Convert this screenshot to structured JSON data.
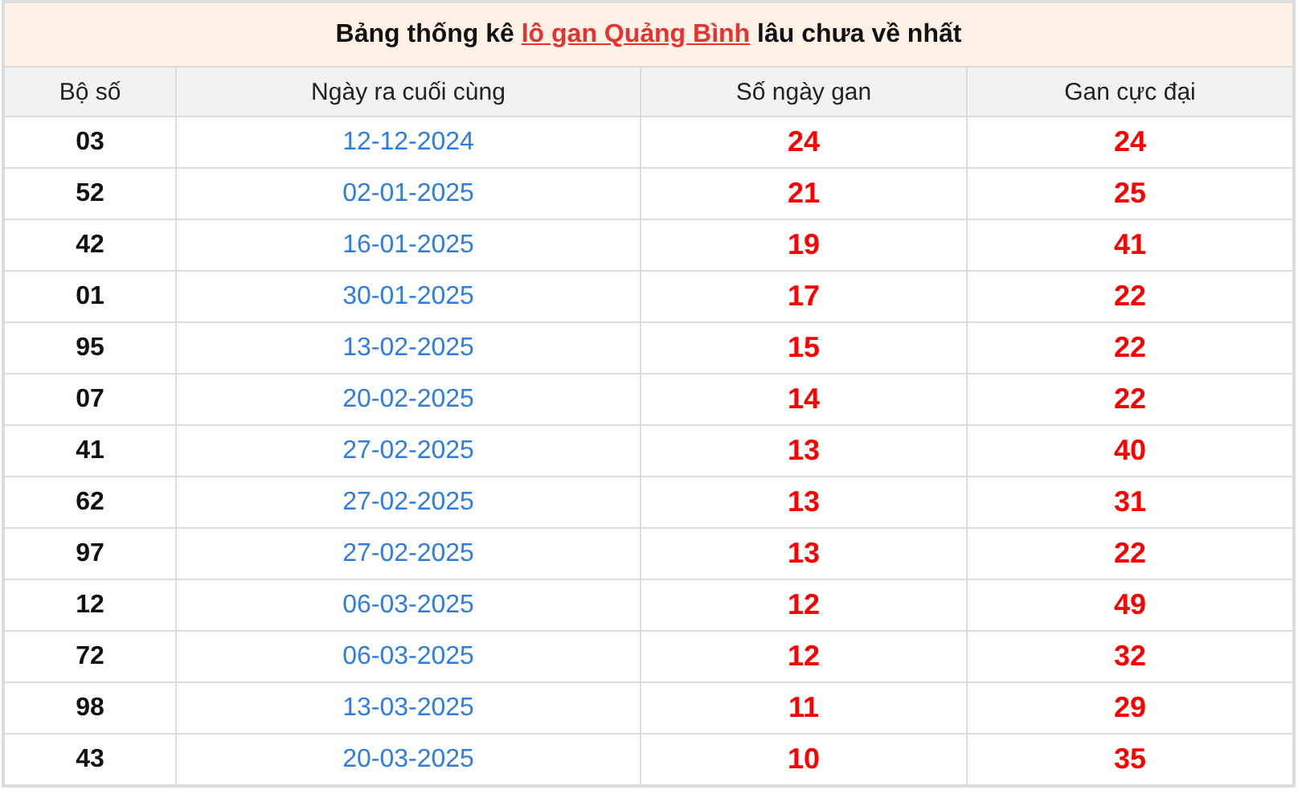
{
  "title": {
    "before": "Bảng thống kê",
    "link": "lô gan Quảng Bình",
    "after": "lâu chưa về nhất"
  },
  "columns": [
    "Bộ số",
    "Ngày ra cuối cùng",
    "Số ngày gan",
    "Gan cực đại"
  ],
  "rows": [
    {
      "number": "03",
      "last_date": "12-12-2024",
      "days": "24",
      "max": "24"
    },
    {
      "number": "52",
      "last_date": "02-01-2025",
      "days": "21",
      "max": "25"
    },
    {
      "number": "42",
      "last_date": "16-01-2025",
      "days": "19",
      "max": "41"
    },
    {
      "number": "01",
      "last_date": "30-01-2025",
      "days": "17",
      "max": "22"
    },
    {
      "number": "95",
      "last_date": "13-02-2025",
      "days": "15",
      "max": "22"
    },
    {
      "number": "07",
      "last_date": "20-02-2025",
      "days": "14",
      "max": "22"
    },
    {
      "number": "41",
      "last_date": "27-02-2025",
      "days": "13",
      "max": "40"
    },
    {
      "number": "62",
      "last_date": "27-02-2025",
      "days": "13",
      "max": "31"
    },
    {
      "number": "97",
      "last_date": "27-02-2025",
      "days": "13",
      "max": "22"
    },
    {
      "number": "12",
      "last_date": "06-03-2025",
      "days": "12",
      "max": "49"
    },
    {
      "number": "72",
      "last_date": "06-03-2025",
      "days": "12",
      "max": "32"
    },
    {
      "number": "98",
      "last_date": "13-03-2025",
      "days": "11",
      "max": "29"
    },
    {
      "number": "43",
      "last_date": "20-03-2025",
      "days": "10",
      "max": "35"
    }
  ]
}
